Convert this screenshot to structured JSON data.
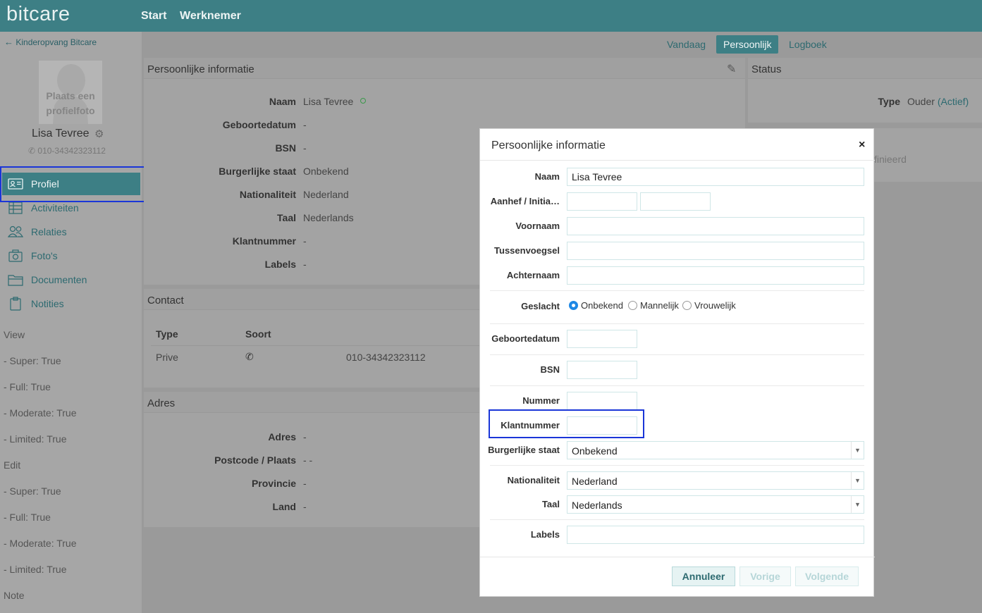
{
  "topbar": {
    "logo": "bitcare",
    "nav": [
      "Start",
      "Werknemer"
    ]
  },
  "sidebar": {
    "back_label": "Kinderopvang Bitcare",
    "avatar_text_line1": "Plaats een",
    "avatar_text_line2": "profielfoto",
    "user_name": "Lisa Tevree",
    "phone": "010-34342323112",
    "items": [
      {
        "label": "Profiel",
        "icon": "profile-card-icon",
        "active": true
      },
      {
        "label": "Activiteiten",
        "icon": "table-icon",
        "active": false
      },
      {
        "label": "Relaties",
        "icon": "people-icon",
        "active": false
      },
      {
        "label": "Foto's",
        "icon": "camera-icon",
        "active": false
      },
      {
        "label": "Documenten",
        "icon": "folder-icon",
        "active": false
      },
      {
        "label": "Notities",
        "icon": "clipboard-icon",
        "active": false
      }
    ],
    "permissions": [
      "View",
      "- Super: True",
      "- Full: True",
      "- Moderate: True",
      "- Limited: True",
      "Edit",
      "- Super: True",
      "- Full: True",
      "- Moderate: True",
      "- Limited: True",
      "Note"
    ]
  },
  "tabs": [
    {
      "label": "Vandaag",
      "active": false
    },
    {
      "label": "Persoonlijk",
      "active": true
    },
    {
      "label": "Logboek",
      "active": false
    }
  ],
  "personal_panel": {
    "title": "Persoonlijke informatie",
    "rows": [
      {
        "label": "Naam",
        "value": "Lisa Tevree"
      },
      {
        "label": "Geboortedatum",
        "value": "-"
      },
      {
        "label": "BSN",
        "value": "-"
      },
      {
        "label": "Burgerlijke staat",
        "value": "Onbekend"
      },
      {
        "label": "Nationaliteit",
        "value": "Nederland"
      },
      {
        "label": "Taal",
        "value": "Nederlands"
      },
      {
        "label": "Klantnummer",
        "value": "-"
      },
      {
        "label": "Labels",
        "value": "-"
      }
    ]
  },
  "status_panel": {
    "title": "Status",
    "type_label": "Type",
    "type_value": "Ouder",
    "type_status": "(Actief)",
    "partial_text": "finieerd"
  },
  "contact_panel": {
    "title": "Contact",
    "col_type": "Type",
    "col_sort": "Soort",
    "row_type": "Prive",
    "row_value": "010-34342323112"
  },
  "address_panel": {
    "title": "Adres",
    "rows": [
      {
        "label": "Adres",
        "value": "-"
      },
      {
        "label": "Postcode / Plaats",
        "value": "- -"
      },
      {
        "label": "Provincie",
        "value": "-"
      },
      {
        "label": "Land",
        "value": "-"
      }
    ]
  },
  "modal": {
    "title": "Persoonlijke informatie",
    "close": "×",
    "labels": {
      "naam": "Naam",
      "aanhef": "Aanhef / Initia…",
      "voornaam": "Voornaam",
      "tussenvoegsel": "Tussenvoegsel",
      "achternaam": "Achternaam",
      "geslacht": "Geslacht",
      "geboortedatum": "Geboortedatum",
      "bsn": "BSN",
      "nummer": "Nummer",
      "klantnummer": "Klantnummer",
      "burgerlijke_staat": "Burgerlijke staat",
      "nationaliteit": "Nationaliteit",
      "taal": "Taal",
      "labels": "Labels"
    },
    "values": {
      "naam": "Lisa Tevree",
      "burgerlijke_staat": "Onbekend",
      "nationaliteit": "Nederland",
      "taal": "Nederlands"
    },
    "gender_options": [
      "Onbekend",
      "Mannelijk",
      "Vrouwelijk"
    ],
    "gender_selected": "Onbekend",
    "buttons": {
      "cancel": "Annuleer",
      "previous": "Vorige",
      "next": "Volgende"
    }
  }
}
